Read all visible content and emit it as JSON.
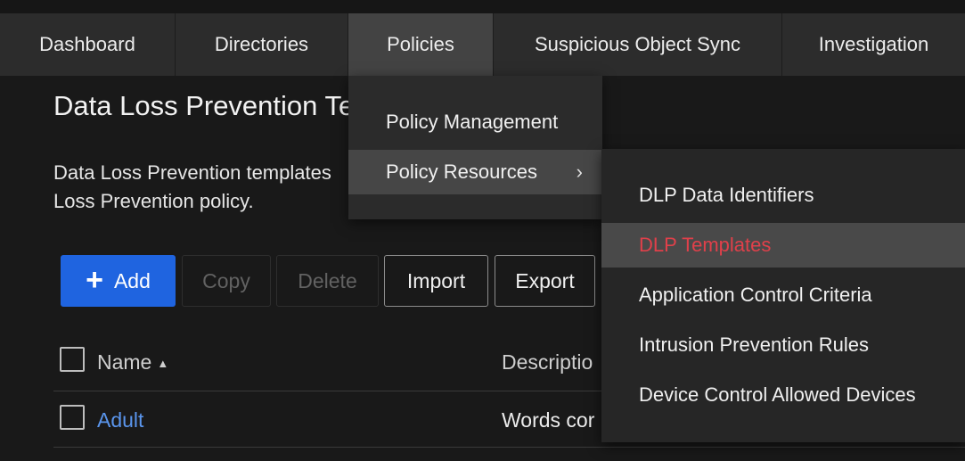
{
  "nav": {
    "items": [
      "Dashboard",
      "Directories",
      "Policies",
      "Suspicious Object Sync",
      "Investigation"
    ],
    "active": "Policies"
  },
  "page": {
    "title": "Data Loss Prevention Te",
    "description": "Data Loss Prevention templates Loss Prevention policy."
  },
  "toolbar": {
    "add": "Add",
    "copy": "Copy",
    "delete": "Delete",
    "import": "Import",
    "export": "Export"
  },
  "table": {
    "columns": [
      "Name",
      "Descriptio"
    ],
    "rows": [
      {
        "name": "Adult",
        "description": "Words cor"
      }
    ]
  },
  "policies_menu": {
    "items": [
      "Policy Management",
      "Policy Resources"
    ]
  },
  "resources_menu": {
    "items": [
      "DLP Data Identifiers",
      "DLP Templates",
      "Application Control Criteria",
      "Intrusion Prevention Rules",
      "Device Control Allowed Devices"
    ],
    "selected": "DLP Templates"
  },
  "colors": {
    "accent": "#1f64e0",
    "link": "#5a95ec",
    "selected_text": "#e0404a"
  }
}
